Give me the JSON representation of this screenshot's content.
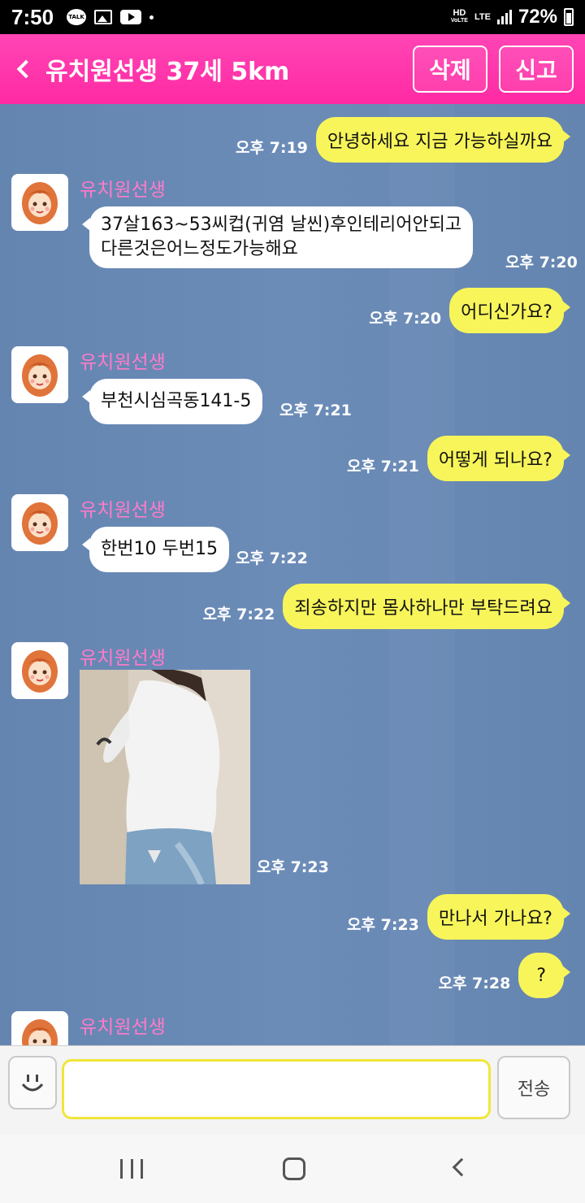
{
  "status_bar": {
    "time": "7:50",
    "talk_label": "TALK",
    "hd_label": "HD",
    "voice_label": "VoLTE",
    "lte_label": "LTE",
    "battery": "72%"
  },
  "header": {
    "title": "유치원선생 37세 5km",
    "delete_label": "삭제",
    "report_label": "신고",
    "accent_color": "#ff2aa3"
  },
  "sender_name": "유치원선생",
  "messages": [
    {
      "side": "out",
      "time": "오후 7:19",
      "text": "안녕하세요 지금 가능하실까요"
    },
    {
      "side": "in",
      "time": "오후 7:20",
      "line1": "37살163~53씨컵(귀염 날씬)후인테리어안되고",
      "line2": "다른것은어느정도가능해요"
    },
    {
      "side": "out",
      "time": "오후 7:20",
      "text": "어디신가요?"
    },
    {
      "side": "in",
      "time": "오후 7:21",
      "text": "부천시심곡동141-5"
    },
    {
      "side": "out",
      "time": "오후 7:21",
      "text": "어떻게 되나요?"
    },
    {
      "side": "in",
      "time": "오후 7:22",
      "text": "한번10 두번15"
    },
    {
      "side": "out",
      "time": "오후 7:22",
      "text": "죄송하지만 몸사하나만 부탁드려요"
    },
    {
      "side": "in",
      "time": "오후 7:23",
      "type": "photo"
    },
    {
      "side": "out",
      "time": "오후 7:23",
      "text": "만나서 가나요?"
    },
    {
      "side": "out",
      "time": "오후 7:28",
      "text": "?"
    }
  ],
  "input": {
    "value": "",
    "send_label": "전송"
  }
}
